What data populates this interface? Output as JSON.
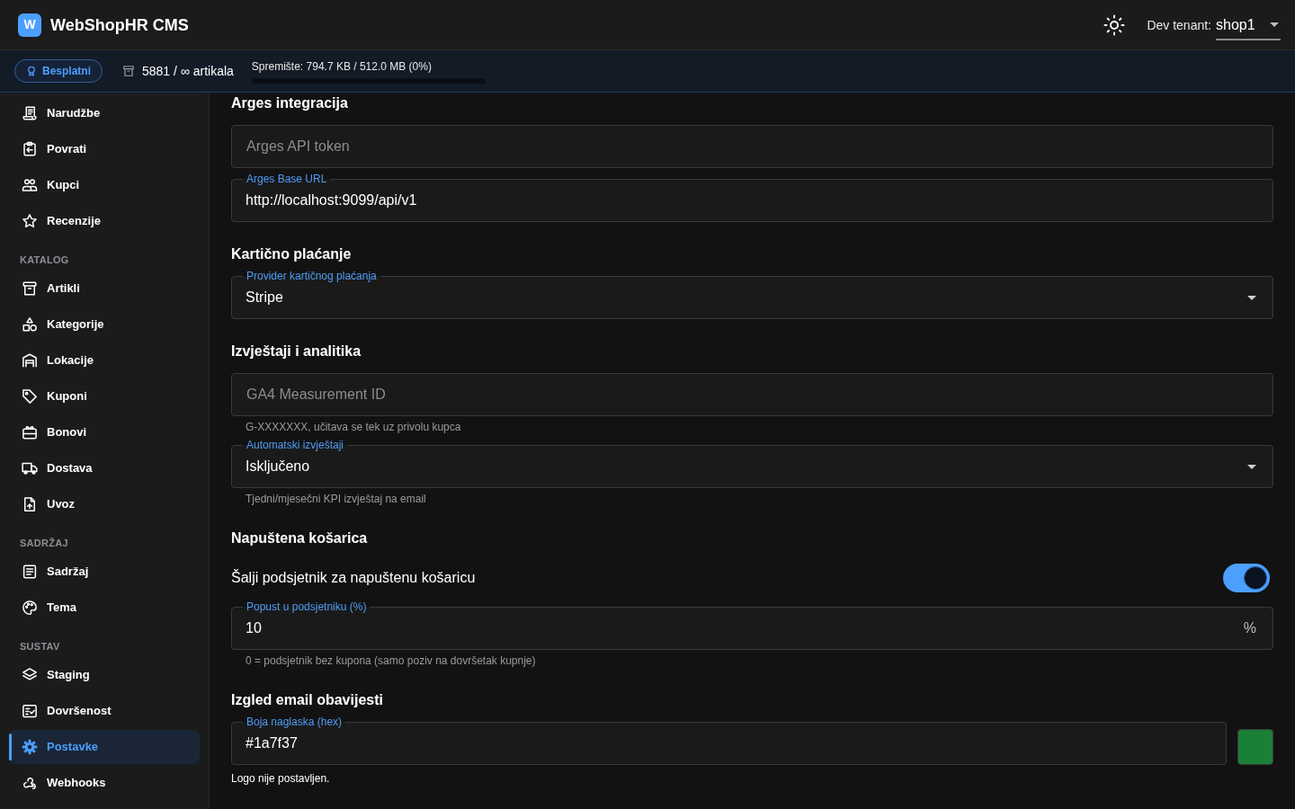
{
  "header": {
    "logo_letter": "W",
    "title": "WebShopHR CMS",
    "tenant_label": "Dev tenant:",
    "tenant": "shop1"
  },
  "plan_bar": {
    "plan": "Besplatni",
    "articles": "5881 / ∞ artikala",
    "storage": {
      "label": "Spremište: 794.7 KB / 512.0 MB (0%)",
      "level": 0
    }
  },
  "sidebar": {
    "groups": [
      {
        "items": [
          {
            "label": "Narudžbe",
            "selected": false
          },
          {
            "label": "Povrati",
            "selected": false
          },
          {
            "label": "Kupci",
            "selected": false
          },
          {
            "label": "Recenzije",
            "selected": false
          }
        ]
      },
      {
        "title": "KATALOG",
        "items": [
          {
            "label": "Artikli",
            "selected": false
          },
          {
            "label": "Kategorije",
            "selected": false
          },
          {
            "label": "Lokacije",
            "selected": false
          },
          {
            "label": "Kuponi",
            "selected": false
          },
          {
            "label": "Bonovi",
            "selected": false
          },
          {
            "label": "Dostava",
            "selected": false
          },
          {
            "label": "Uvoz",
            "selected": false
          }
        ]
      },
      {
        "title": "SADRŽAJ",
        "items": [
          {
            "label": "Sadržaj",
            "selected": false
          },
          {
            "label": "Tema",
            "selected": false
          }
        ]
      },
      {
        "title": "SUSTAV",
        "items": [
          {
            "label": "Staging",
            "selected": false
          },
          {
            "label": "Dovršenost",
            "selected": false
          },
          {
            "label": "Postavke",
            "selected": true
          },
          {
            "label": "Webhooks",
            "selected": false
          }
        ]
      }
    ]
  },
  "sections": [
    {
      "title": "Arges integracija",
      "fields": [
        {
          "kind": "text",
          "placeholder": "Arges API token"
        },
        {
          "kind": "text",
          "label": "Arges Base URL",
          "value": "http://localhost:9099/api/v1"
        }
      ]
    },
    {
      "title": "Kartično plaćanje",
      "fields": [
        {
          "kind": "select",
          "label": "Provider kartičnog plaćanja",
          "value": "Stripe"
        }
      ]
    },
    {
      "title": "Izvještaji i analitika",
      "fields": [
        {
          "kind": "text",
          "placeholder": "GA4 Measurement ID",
          "helper": "G-XXXXXXX, učitava se tek uz privolu kupca"
        },
        {
          "kind": "select",
          "label": "Automatski izvještaji",
          "value": "Isključeno",
          "helper": "Tjedni/mjesečni KPI izvještaj na email"
        }
      ]
    },
    {
      "title": "Napuštena košarica",
      "fields": [
        {
          "kind": "switch",
          "label": "Šalji podsjetnik za napuštenu košaricu",
          "on": true
        },
        {
          "kind": "text",
          "label": "Popust u podsjetniku (%)",
          "value": "10",
          "suffix": "%",
          "helper": "0 = podsjetnik bez kupona (samo poziv na dovršetak kupnje)"
        }
      ]
    },
    {
      "title": "Izgled email obavijesti",
      "fields": [
        {
          "kind": "color",
          "label": "Boja naglaska (hex)",
          "value": "#1a7f37",
          "color": "#1a7f37"
        },
        {
          "kind": "note",
          "text": "Logo nije postavljen."
        }
      ]
    }
  ]
}
